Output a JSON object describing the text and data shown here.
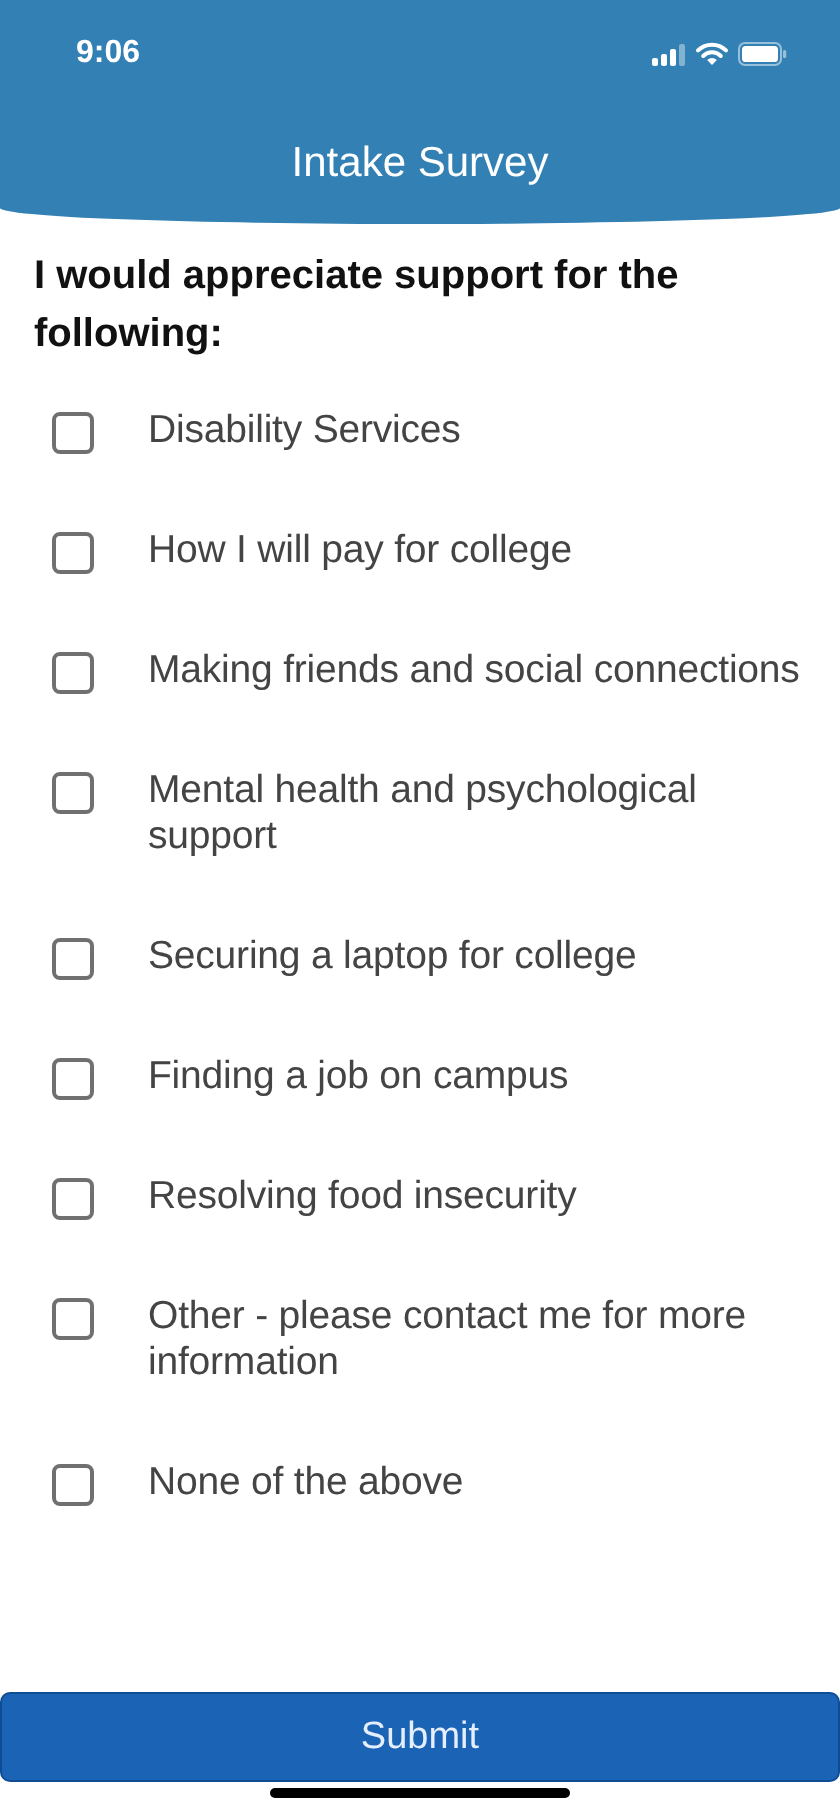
{
  "status_bar": {
    "time": "9:06"
  },
  "header": {
    "title": "Intake Survey"
  },
  "question": "I would appreciate support for the following:",
  "options": [
    {
      "label": "Disability Services",
      "checked": false
    },
    {
      "label": "How I will pay for college",
      "checked": false
    },
    {
      "label": "Making friends and social connections",
      "checked": false
    },
    {
      "label": "Mental health and psychological support",
      "checked": false
    },
    {
      "label": "Securing a laptop for college",
      "checked": false
    },
    {
      "label": "Finding a job on campus",
      "checked": false
    },
    {
      "label": "Resolving food insecurity",
      "checked": false
    },
    {
      "label": "Other - please contact me for more information",
      "checked": false
    },
    {
      "label": "None of the above",
      "checked": false
    }
  ],
  "submit": {
    "label": "Submit"
  }
}
